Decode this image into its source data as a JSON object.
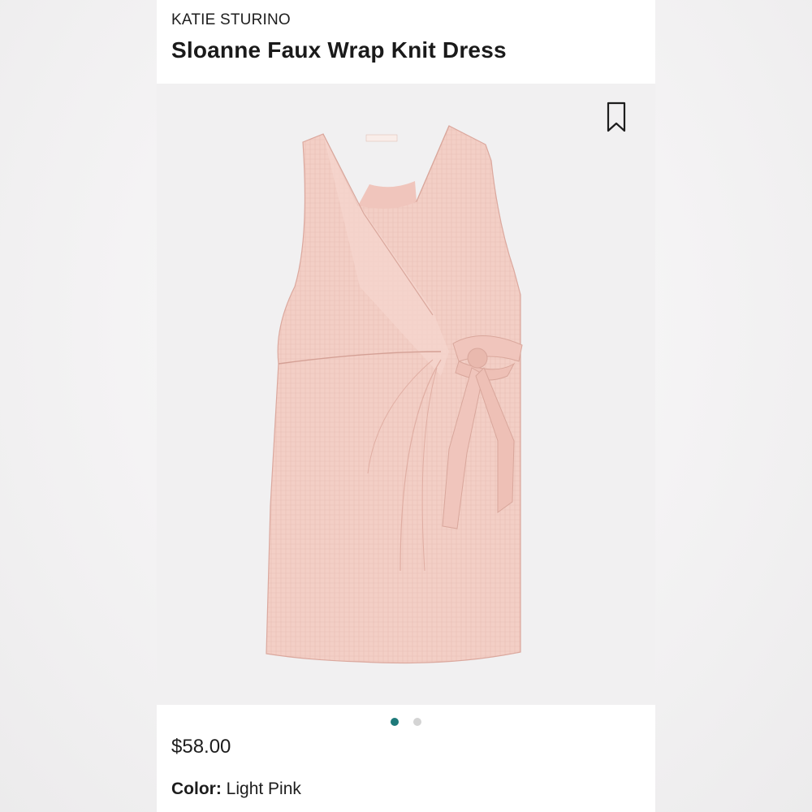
{
  "product": {
    "brand": "KATIE STURINO",
    "name": "Sloanne Faux Wrap Knit Dress",
    "price": "$58.00",
    "color_label": "Color:",
    "color_value": "Light Pink"
  },
  "image": {
    "dress_color": "#f3cfc6",
    "dress_shadow": "#e4b7ad",
    "background": "#f1f0f1",
    "bookmark_icon": "bookmark-icon"
  },
  "carousel": {
    "count": 2,
    "active_index": 0,
    "active_color": "#1e7a7a",
    "inactive_color": "#d4d4d4"
  }
}
